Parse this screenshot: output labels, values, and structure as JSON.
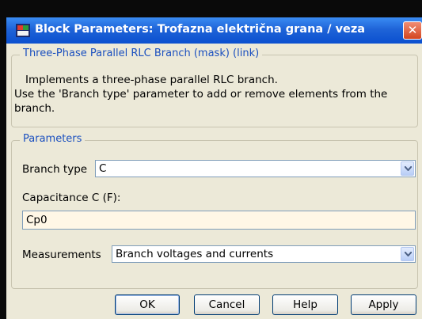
{
  "window": {
    "title": "Block Parameters: Trofazna električna grana / veza",
    "close_glyph": "✕",
    "icon": "simulink-block-icon"
  },
  "description_group": {
    "title": "Three-Phase Parallel RLC Branch (mask) (link)",
    "lines": [
      "Implements a three-phase parallel RLC branch.",
      "Use the 'Branch type' parameter to add or remove elements from the",
      "branch."
    ]
  },
  "parameters_group": {
    "title": "Parameters",
    "branch_type": {
      "label": "Branch type",
      "value": "C"
    },
    "capacitance": {
      "label": "Capacitance C (F):",
      "value": "Cp0"
    },
    "measurements": {
      "label": "Measurements",
      "value": "Branch voltages and currents"
    }
  },
  "buttons": {
    "ok": "OK",
    "cancel": "Cancel",
    "help": "Help",
    "apply": "Apply"
  }
}
